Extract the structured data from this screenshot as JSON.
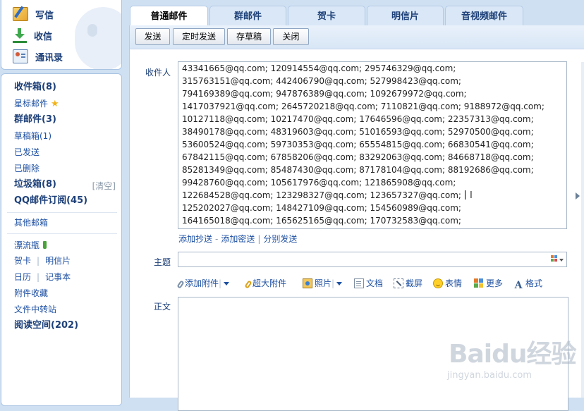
{
  "quick_actions": {
    "write": "写信",
    "receive": "收信",
    "contacts": "通讯录"
  },
  "folders": {
    "inbox": "收件箱(8)",
    "starred": "星标邮件",
    "group_mail": "群邮件(3)",
    "drafts": "草稿箱(1)",
    "sent": "已发送",
    "deleted": "已删除",
    "spam": "垃圾箱(8)",
    "spam_clear": "[清空]",
    "qq_subscriptions": "QQ邮件订阅(45)",
    "other_mailbox": "其他邮箱",
    "drift_bottle": "漂流瓶",
    "greeting_card": "贺卡",
    "postcard": "明信片",
    "calendar": "日历",
    "notebook": "记事本",
    "attachment_favorites": "附件收藏",
    "file_transfer": "文件中转站",
    "reading_space": "阅读空间(202)"
  },
  "tabs": [
    "普通邮件",
    "群邮件",
    "贺卡",
    "明信片",
    "音视频邮件"
  ],
  "toolbar": {
    "send": "发送",
    "scheduled_send": "定时发送",
    "save_draft": "存草稿",
    "close": "关闭"
  },
  "compose": {
    "to_label": "收件人",
    "recipients": [
      "43341665@qq.com; 120914554@qq.com; 295746329@qq.com;",
      "315763151@qq.com; 442406790@qq.com; 527998423@qq.com;",
      "794169389@qq.com; 947876389@qq.com; 1092679972@qq.com;",
      "1417037921@qq.com; 2645720218@qq.com; 7110821@qq.com; 9188972@qq.com;",
      "10127118@qq.com; 10217470@qq.com; 17646596@qq.com; 22357313@qq.com;",
      "38490178@qq.com; 48319603@qq.com; 51016593@qq.com; 52970500@qq.com;",
      "53600524@qq.com; 59730353@qq.com; 65554815@qq.com; 66830541@qq.com;",
      "67842115@qq.com; 67858206@qq.com; 83292063@qq.com; 84668718@qq.com;",
      "85281349@qq.com; 85487430@qq.com; 87178104@qq.com; 88192686@qq.com;",
      "99428760@qq.com; 105617976@qq.com; 121865908@qq.com;",
      "122684528@qq.com; 123298327@qq.com; 123657327@qq.com;",
      "125202027@qq.com; 148427109@qq.com; 154560989@qq.com;",
      "164165018@qq.com; 165625165@qq.com; 170732583@qq.com;"
    ],
    "add_cc": "添加抄送",
    "add_bcc": "添加密送",
    "separate_send": "分别发送",
    "subject_label": "主题",
    "subject_value": "",
    "body_label": "正文",
    "body_value": ""
  },
  "attach_bar": {
    "add_attachment": "添加附件",
    "large_attachment": "超大附件",
    "photo": "照片",
    "document": "文档",
    "screenshot": "截屏",
    "emoticon": "表情",
    "more": "更多",
    "format": "格式",
    "format_icon_letter": "A"
  },
  "watermark": {
    "main": "Baidu经验",
    "sub": "jingyan.baidu.com"
  }
}
